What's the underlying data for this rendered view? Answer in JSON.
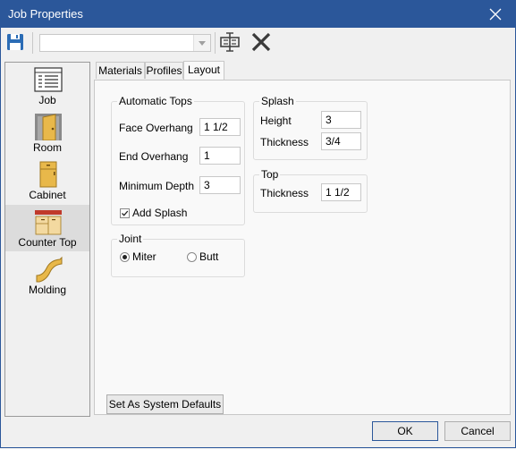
{
  "window": {
    "title": "Job Properties"
  },
  "toolbar": {
    "combo_value": ""
  },
  "nav": {
    "items": [
      {
        "label": "Job",
        "icon": "job-list-icon"
      },
      {
        "label": "Room",
        "icon": "room-door-icon"
      },
      {
        "label": "Cabinet",
        "icon": "cabinet-icon"
      },
      {
        "label": "Counter Top",
        "icon": "counter-top-icon",
        "selected": true
      },
      {
        "label": "Molding",
        "icon": "molding-icon"
      }
    ]
  },
  "tabs": [
    {
      "label": "Materials"
    },
    {
      "label": "Profiles"
    },
    {
      "label": "Layout",
      "active": true
    }
  ],
  "automatic_tops": {
    "title": "Automatic Tops",
    "face_overhang_label": "Face Overhang",
    "face_overhang_value": "1 1/2",
    "end_overhang_label": "End Overhang",
    "end_overhang_value": "1",
    "minimum_depth_label": "Minimum Depth",
    "minimum_depth_value": "3",
    "add_splash_label": "Add Splash",
    "add_splash_checked": true
  },
  "joint": {
    "title": "Joint",
    "miter_label": "Miter",
    "butt_label": "Butt",
    "selected": "Miter"
  },
  "splash": {
    "title": "Splash",
    "height_label": "Height",
    "height_value": "3",
    "thickness_label": "Thickness",
    "thickness_value": "3/4"
  },
  "top": {
    "title": "Top",
    "thickness_label": "Thickness",
    "thickness_value": "1 1/2"
  },
  "buttons": {
    "system_defaults": "Set As System Defaults",
    "ok": "OK",
    "cancel": "Cancel"
  },
  "colors": {
    "titlebar": "#2b579a",
    "accent": "#2b579a"
  }
}
